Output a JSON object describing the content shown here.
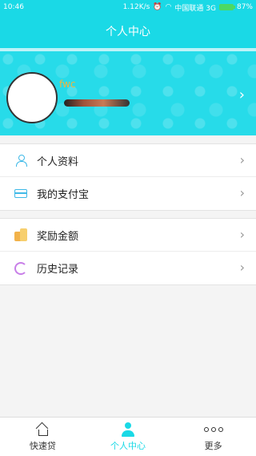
{
  "status_bar": {
    "time": "10:46",
    "network_speed": "1.12K/s",
    "carrier": "中国联通 3G",
    "battery": "87%"
  },
  "header": {
    "title": "个人中心"
  },
  "profile": {
    "name": "fwc"
  },
  "menu": {
    "section1": [
      {
        "label": "个人资料",
        "icon": "user-icon"
      },
      {
        "label": "我的支付宝",
        "icon": "card-icon"
      }
    ],
    "section2": [
      {
        "label": "奖励金额",
        "icon": "coins-icon"
      },
      {
        "label": "历史记录",
        "icon": "history-icon"
      }
    ]
  },
  "tabs": [
    {
      "label": "快速贷",
      "icon": "home-icon"
    },
    {
      "label": "个人中心",
      "icon": "person-icon",
      "active": true
    },
    {
      "label": "更多",
      "icon": "more-icon"
    }
  ],
  "colors": {
    "primary": "#1ad9e6",
    "name_text": "#f5b43a"
  }
}
